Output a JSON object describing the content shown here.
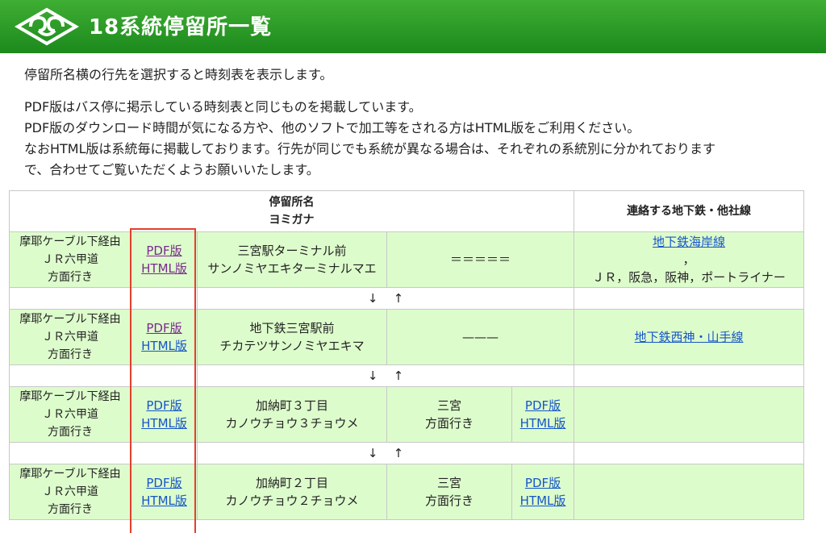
{
  "header": {
    "title": "18系統停留所一覧",
    "colors": {
      "bar": "#2a9a26",
      "text": "#ffffff"
    },
    "logo_icon": "kobe-city-emblem-icon"
  },
  "intro": {
    "line1": "停留所名横の行先を選択すると時刻表を表示します。",
    "line2": "PDF版はバス停に掲示している時刻表と同じものを掲載しています。",
    "line3": "PDF版のダウンロード時間が気になる方や、他のソフトで加工等をされる方はHTML版をご利用ください。",
    "line4": "なおHTML版は系統毎に掲載しております。行先が同じでも系統が異なる場合は、それぞれの系統別に分かれております",
    "line5": "で、合わせてご覧いただくようお願いいたします。"
  },
  "table": {
    "header_stop": "停留所名",
    "header_reading": "ヨミガナ",
    "header_connect": "連絡する地下鉄・他社線",
    "arrow_down": "↓",
    "arrow_up": "↑",
    "rows": [
      {
        "route_line1": "摩耶ケーブル下経由",
        "route_line2": "ＪＲ六甲道",
        "route_line3": "方面行き",
        "pdf": "PDF版",
        "html": "HTML版",
        "name": "三宮駅ターミナル前",
        "reading": "サンノミヤエキターミナルマエ",
        "dest": "＝＝＝＝＝",
        "connect_link": "地下鉄海岸線",
        "connect_sep": "，",
        "connect_text": "ＪＲ，阪急，阪神，ポートライナー"
      },
      {
        "route_line1": "摩耶ケーブル下経由",
        "route_line2": "ＪＲ六甲道",
        "route_line3": "方面行き",
        "pdf": "PDF版",
        "html": "HTML版",
        "name": "地下鉄三宮駅前",
        "reading": "チカテツサンノミヤエキマ",
        "dest": "———",
        "connect_link": "地下鉄西神・山手線"
      },
      {
        "route_line1": "摩耶ケーブル下経由",
        "route_line2": "ＪＲ六甲道",
        "route_line3": "方面行き",
        "pdf": "PDF版",
        "html": "HTML版",
        "name": "加納町３丁目",
        "reading": "カノウチョウ３チョウメ",
        "dest_line1": "三宮",
        "dest_line2": "方面行き",
        "dest_pdf": "PDF版",
        "dest_html": "HTML版"
      },
      {
        "route_line1": "摩耶ケーブル下経由",
        "route_line2": "ＪＲ六甲道",
        "route_line3": "方面行き",
        "pdf": "PDF版",
        "html": "HTML版",
        "name": "加納町２丁目",
        "reading": "カノウチョウ２チョウメ",
        "dest_line1": "三宮",
        "dest_line2": "方面行き",
        "dest_pdf": "PDF版",
        "dest_html": "HTML版"
      }
    ]
  },
  "colors": {
    "row_bg": "#ddfccc",
    "link": "#1655c9",
    "link_visited": "#7a2a8c",
    "highlight_border": "#e2402c"
  }
}
